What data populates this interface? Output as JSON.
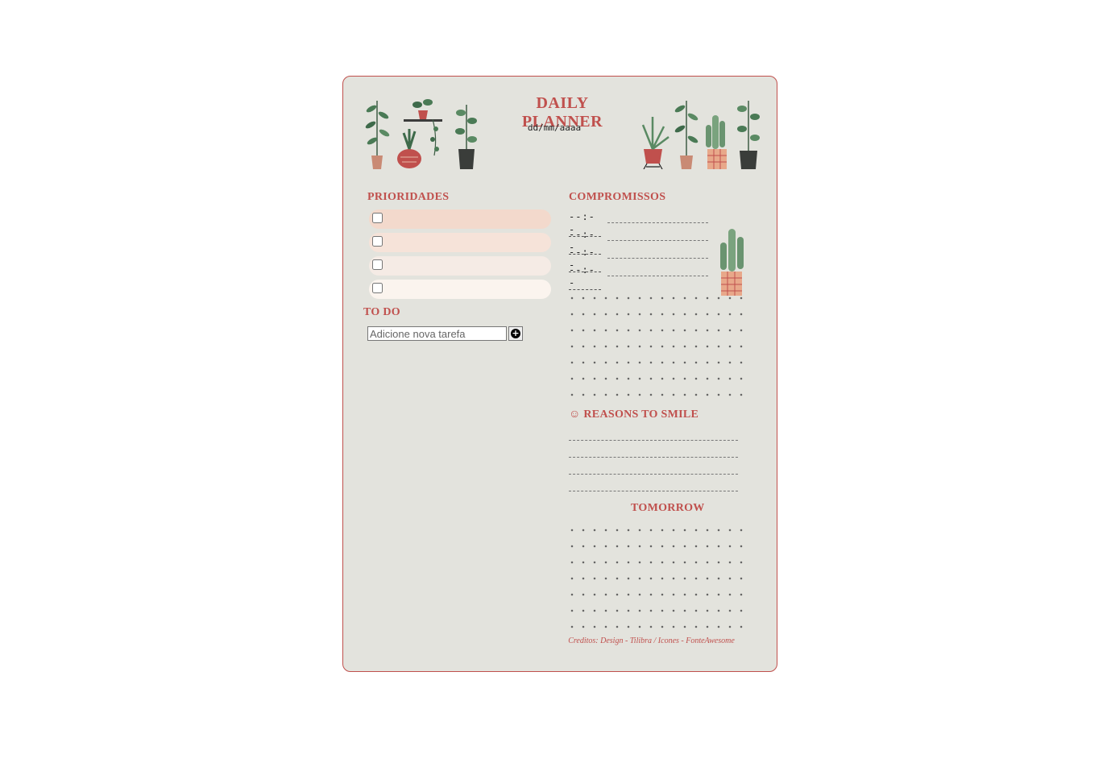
{
  "header": {
    "title": "DAILY PLANNER",
    "date_placeholder": "dd/mm/aaaa"
  },
  "prioridades": {
    "heading": "PRIORIDADES",
    "items": [
      {
        "color": "#f3d9cc"
      },
      {
        "color": "#f6e3d9"
      },
      {
        "color": "#f5ebe5"
      },
      {
        "color": "#fbf4ee"
      }
    ]
  },
  "todo": {
    "heading": "TO DO",
    "placeholder": "Adicione nova tarefa",
    "add_icon": "plus-circle-icon"
  },
  "compromissos": {
    "heading": "COMPROMISSOS",
    "times": [
      "--:--",
      "--:--",
      "--:--",
      "--:--"
    ]
  },
  "smile": {
    "heading": "☺ REASONS TO SMILE"
  },
  "tomorrow": {
    "heading": "TOMORROW"
  },
  "credits": "Creditos: Design - Tilibra / Icones - FonteAwesome",
  "colors": {
    "accent": "#c0504d",
    "card_bg": "#e3e3dd"
  }
}
